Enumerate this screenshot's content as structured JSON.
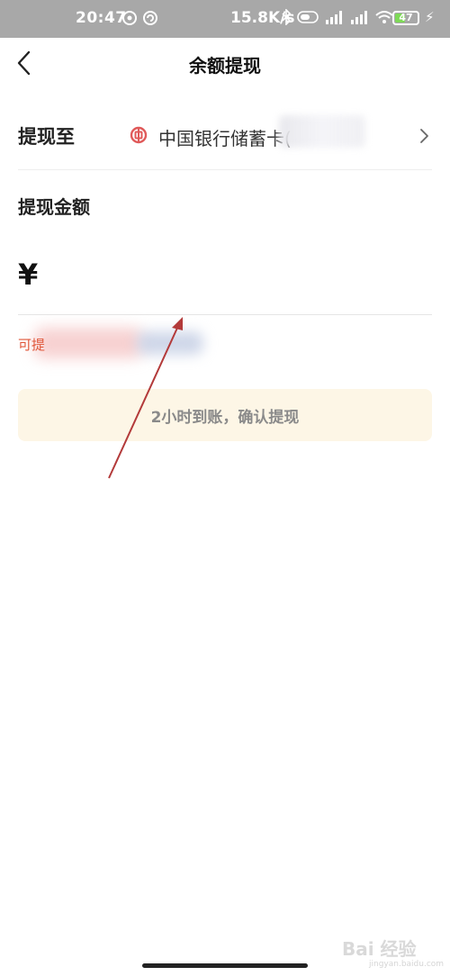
{
  "status_bar": {
    "time": "20:47",
    "network_speed": "15.8K/s",
    "battery": "47",
    "battery_level": 0.47,
    "accent": "#7ed957"
  },
  "header": {
    "title": "余额提现",
    "back_icon": "chevron-left-icon"
  },
  "withdraw_to": {
    "label": "提现至",
    "bank_icon": "bank-of-china-icon",
    "bank_name": "中国银行储蓄卡(",
    "chevron_icon": "chevron-right-icon",
    "brand_color": "#e05a5a"
  },
  "amount": {
    "label": "提现金额",
    "currency_symbol": "¥",
    "value": ""
  },
  "available": {
    "text": "可提"
  },
  "confirm_button": {
    "label": "2小时到账，确认提现",
    "background": "#fdf6e6"
  },
  "watermark": {
    "text": "Bai 经验",
    "url": "jingyan.baidu.com"
  }
}
